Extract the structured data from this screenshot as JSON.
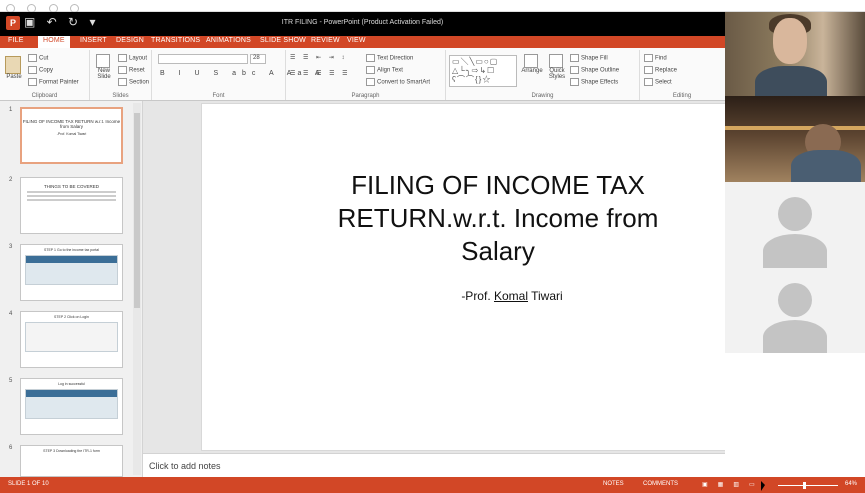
{
  "window": {
    "title": "ITR FILING - PowerPoint (Product Activation Failed)"
  },
  "ribbon_tabs": [
    "FILE",
    "HOME",
    "INSERT",
    "DESIGN",
    "TRANSITIONS",
    "ANIMATIONS",
    "SLIDE SHOW",
    "REVIEW",
    "VIEW"
  ],
  "ribbon": {
    "clipboard": {
      "cut": "Cut",
      "copy": "Copy",
      "paste": "Paste",
      "format_painter": "Format Painter",
      "label": "Clipboard"
    },
    "slides": {
      "new_slide": "New Slide",
      "layout": "Layout",
      "reset": "Reset",
      "section": "Section",
      "label": "Slides"
    },
    "font": {
      "label": "Font",
      "size": "28"
    },
    "paragraph": {
      "text_direction": "Text Direction",
      "align_text": "Align Text",
      "convert_smartart": "Convert to SmartArt",
      "label": "Paragraph"
    },
    "drawing": {
      "arrange": "Arrange",
      "quick_styles": "Quick Styles",
      "shape_fill": "Shape Fill",
      "shape_outline": "Shape Outline",
      "shape_effects": "Shape Effects",
      "label": "Drawing"
    },
    "editing": {
      "find": "Find",
      "replace": "Replace",
      "select": "Select",
      "label": "Editing"
    }
  },
  "thumbnails": [
    {
      "num": "1",
      "title": "FILING OF INCOME TAX RETURN w.r.t. Income from Salary",
      "sub": "-Prof. Komal Tiwari"
    },
    {
      "num": "2",
      "title": "THINGS TO BE COVERED"
    },
    {
      "num": "3",
      "title": "STEP 1 Go to the income tax portal"
    },
    {
      "num": "4",
      "title": "STEP 2 Click on Login"
    },
    {
      "num": "5",
      "title": "Log in successful"
    },
    {
      "num": "6",
      "title": "STEP 3 Downloading the ITR-1 form"
    }
  ],
  "slide": {
    "title": "FILING OF INCOME TAX RETURN.w.r.t. Income from Salary",
    "subtitle_prefix": "-Prof. ",
    "subtitle_name": "Komal",
    "subtitle_suffix": " Tiwari"
  },
  "notes_placeholder": "Click to add notes",
  "status": {
    "slide_indicator": "SLIDE 1 OF 10",
    "notes": "NOTES",
    "comments": "COMMENTS",
    "zoom": "64%"
  }
}
